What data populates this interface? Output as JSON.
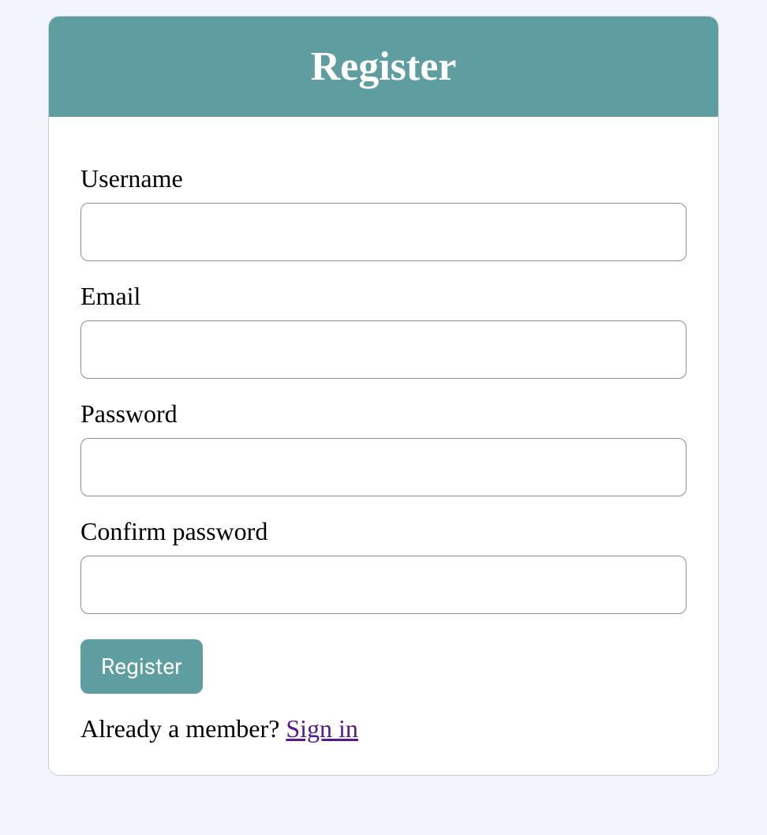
{
  "header": {
    "title": "Register"
  },
  "form": {
    "fields": {
      "username": {
        "label": "Username",
        "value": ""
      },
      "email": {
        "label": "Email",
        "value": ""
      },
      "password": {
        "label": "Password",
        "value": ""
      },
      "confirm_password": {
        "label": "Confirm password",
        "value": ""
      }
    },
    "submit_label": "Register"
  },
  "footer": {
    "prompt": "Already a member? ",
    "link_text": "Sign in"
  }
}
